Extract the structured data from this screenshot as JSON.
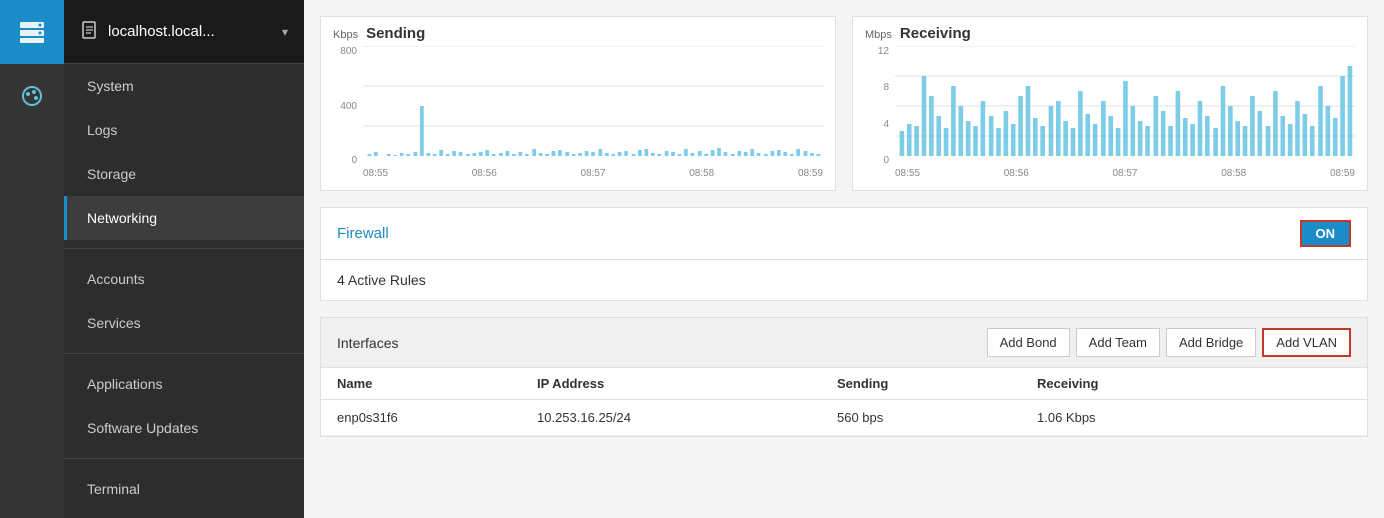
{
  "iconSidebar": {
    "topIcon": "server-icon",
    "items": [
      {
        "name": "dashboard-icon",
        "symbol": "🎨",
        "active": true
      }
    ]
  },
  "navHeader": {
    "icon": "document-icon",
    "title": "localhost.local...",
    "chevron": "▾"
  },
  "navItems": [
    {
      "id": "system",
      "label": "System",
      "active": false
    },
    {
      "id": "logs",
      "label": "Logs",
      "active": false
    },
    {
      "id": "storage",
      "label": "Storage",
      "active": false
    },
    {
      "id": "networking",
      "label": "Networking",
      "active": true
    },
    {
      "id": "accounts",
      "label": "Accounts",
      "active": false
    },
    {
      "id": "services",
      "label": "Services",
      "active": false
    },
    {
      "id": "applications",
      "label": "Applications",
      "active": false
    },
    {
      "id": "software-updates",
      "label": "Software Updates",
      "active": false
    },
    {
      "id": "terminal",
      "label": "Terminal",
      "active": false
    }
  ],
  "sendingChart": {
    "unit": "Kbps",
    "title": "Sending",
    "yLabels": [
      "800",
      "400",
      "0"
    ],
    "xLabels": [
      "08:55",
      "08:56",
      "08:57",
      "08:58",
      "08:59"
    ]
  },
  "receivingChart": {
    "unit": "Mbps",
    "title": "Receiving",
    "yLabels": [
      "12",
      "8",
      "4",
      "0"
    ],
    "xLabels": [
      "08:55",
      "08:56",
      "08:57",
      "08:58",
      "08:59"
    ]
  },
  "firewall": {
    "linkLabel": "Firewall",
    "toggleLabel": "ON",
    "rulesText": "4 Active Rules"
  },
  "interfaces": {
    "title": "Interfaces",
    "buttons": [
      {
        "id": "add-bond",
        "label": "Add Bond",
        "highlighted": false
      },
      {
        "id": "add-team",
        "label": "Add Team",
        "highlighted": false
      },
      {
        "id": "add-bridge",
        "label": "Add Bridge",
        "highlighted": false
      },
      {
        "id": "add-vlan",
        "label": "Add VLAN",
        "highlighted": true
      }
    ],
    "columns": [
      "Name",
      "IP Address",
      "Sending",
      "Receiving"
    ],
    "rows": [
      {
        "name": "enp0s31f6",
        "ip": "10.253.16.25/24",
        "sending": "560 bps",
        "receiving": "1.06 Kbps"
      }
    ]
  }
}
